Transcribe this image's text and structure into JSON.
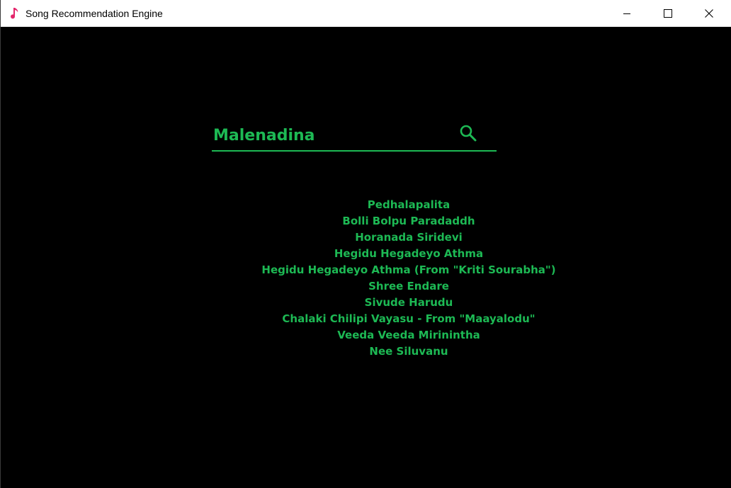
{
  "window": {
    "title": "Song Recommendation Engine",
    "app_icon": "music-note-icon",
    "buttons": {
      "minimize": "minimize-icon",
      "maximize": "maximize-icon",
      "close": "close-icon"
    }
  },
  "search": {
    "value": "Malenadina",
    "placeholder": "",
    "icon": "search-icon"
  },
  "results": [
    "Pedhalapalita",
    "Bolli Bolpu Paradaddh",
    "Horanada Siridevi",
    "Hegidu Hegadeyo Athma",
    "Hegidu Hegadeyo Athma (From \"Kriti Sourabha\")",
    "Shree Endare",
    "Sivude Harudu",
    "Chalaki Chilipi Vayasu - From \"Maayalodu\"",
    "Veeda Veeda Mirinintha",
    "Nee Siluvanu"
  ],
  "colors": {
    "accent": "#1db954",
    "background": "#000000",
    "app_icon": "#e3256b",
    "titlebar": "#ffffff"
  }
}
